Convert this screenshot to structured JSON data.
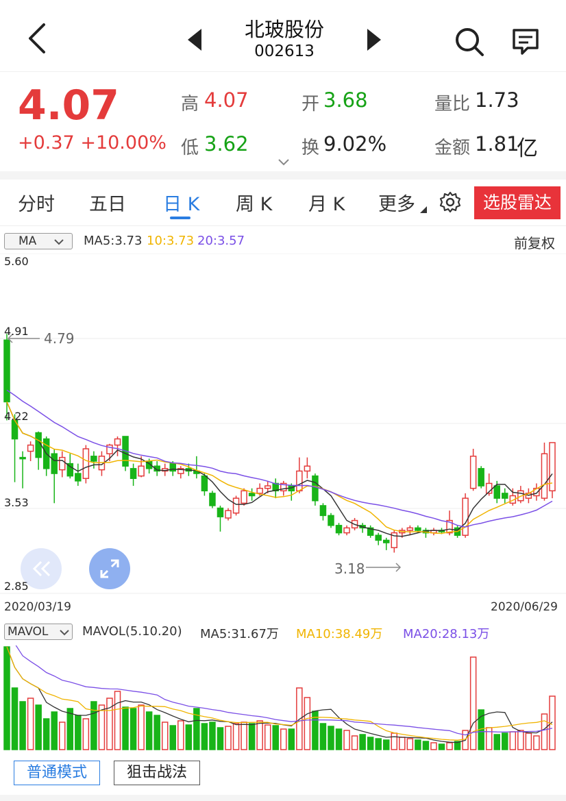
{
  "header": {
    "stock_name": "北玻股份",
    "stock_code": "002613"
  },
  "quote": {
    "price": "4.07",
    "change": "+0.37 +10.00%",
    "high_label": "高",
    "high": "4.07",
    "low_label": "低",
    "low": "3.62",
    "open_label": "开",
    "open": "3.68",
    "turnover_label": "换",
    "turnover": "9.02%",
    "vol_ratio_label": "量比",
    "vol_ratio": "1.73",
    "amount_label": "金额",
    "amount": "1.81",
    "amount_unit": "亿"
  },
  "tabs": {
    "items": [
      "分时",
      "五日",
      "日 K",
      "周 K",
      "月 K",
      "更多"
    ],
    "active": "日 K",
    "radar_button": "选股雷达"
  },
  "kline": {
    "indicator": "MA",
    "ma5": "MA5:3.73",
    "ma10": "10:3.73",
    "ma20": "20:3.57",
    "adjust": "前复权",
    "y_labels": [
      "5.60",
      "4.91",
      "4.22",
      "3.53",
      "2.85"
    ],
    "high_marker": "4.79",
    "low_marker": "3.18",
    "start_date": "2020/03/19",
    "end_date": "2020/06/29",
    "colors": {
      "up": "#e43b3b",
      "down": "#18b418",
      "ma5": "#333333",
      "ma10": "#f0b400",
      "ma20": "#7a4fe6"
    }
  },
  "volume": {
    "indicator": "MAVOL",
    "title": "MAVOL(5.10.20)",
    "ma5": "MA5:31.67万",
    "ma10": "MA10:38.49万",
    "ma20": "MA20:28.13万"
  },
  "bottom": {
    "mode_normal": "普通模式",
    "mode_sniper": "狙击战法"
  }
}
